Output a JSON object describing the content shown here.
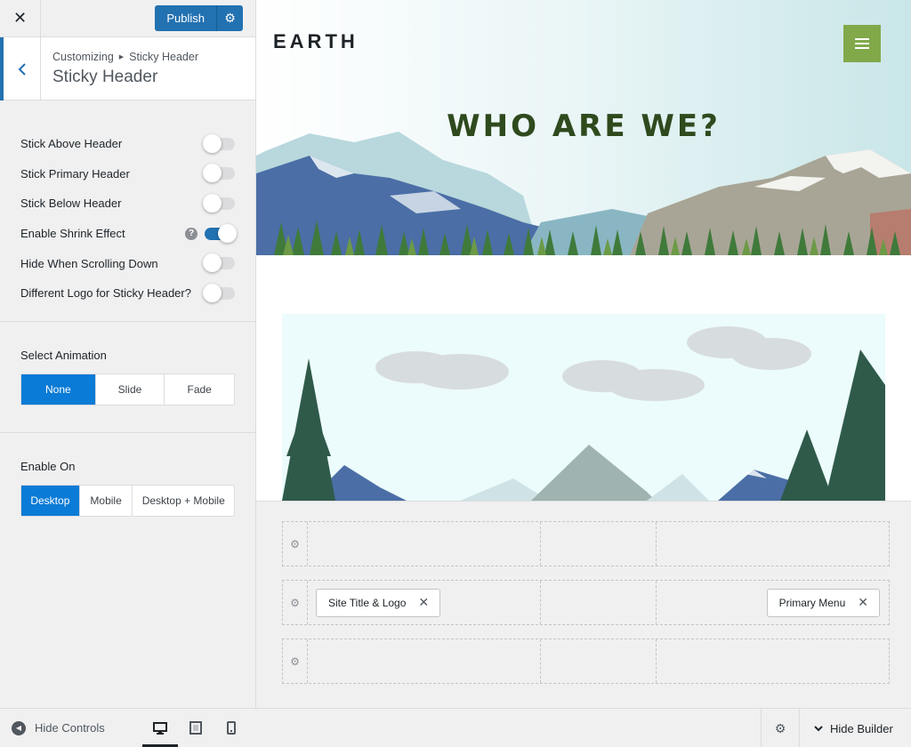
{
  "topbar": {
    "close_icon": "close-icon",
    "publish_label": "Publish",
    "publish_settings_icon": "gear-icon"
  },
  "section": {
    "back_icon": "chevron-left-icon",
    "breadcrumb_root": "Customizing",
    "breadcrumb_current": "Sticky Header",
    "title": "Sticky Header"
  },
  "toggles": [
    {
      "label": "Stick Above Header",
      "on": false
    },
    {
      "label": "Stick Primary Header",
      "on": false
    },
    {
      "label": "Stick Below Header",
      "on": false
    },
    {
      "label": "Enable Shrink Effect",
      "on": true,
      "help_icon": "?"
    },
    {
      "label": "Hide When Scrolling Down",
      "on": false
    },
    {
      "label": "Different Logo for Sticky Header?",
      "on": false
    }
  ],
  "animation": {
    "label": "Select Animation",
    "options": [
      "None",
      "Slide",
      "Fade"
    ],
    "selected": "None"
  },
  "enable_on": {
    "label": "Enable On",
    "options": [
      "Desktop",
      "Mobile",
      "Desktop + Mobile"
    ],
    "selected": "Desktop"
  },
  "panel_footer": {
    "hide_controls_label": "Hide Controls",
    "devices": [
      "desktop-icon",
      "tablet-icon",
      "mobile-icon"
    ],
    "active_device": "desktop-icon"
  },
  "preview": {
    "site_title": "EARTH",
    "heading": "WHO ARE WE?",
    "menu_icon": "hamburger-icon",
    "colors": {
      "menu_button": "#81a94a",
      "heading": "#2f4a1d"
    }
  },
  "builder": {
    "row_gear_icon": "gear-icon",
    "rows": [
      {
        "left": "",
        "right": ""
      },
      {
        "left": "Site Title & Logo",
        "right": "Primary Menu"
      },
      {
        "left": "",
        "right": ""
      }
    ],
    "remove_icon": "✕"
  },
  "builder_footer": {
    "settings_icon": "gear-icon",
    "hide_builder_label": "Hide Builder",
    "chevron_icon": "chevron-down-icon"
  },
  "colors": {
    "accent": "#2271b1",
    "active_option": "#0a7bd6"
  }
}
